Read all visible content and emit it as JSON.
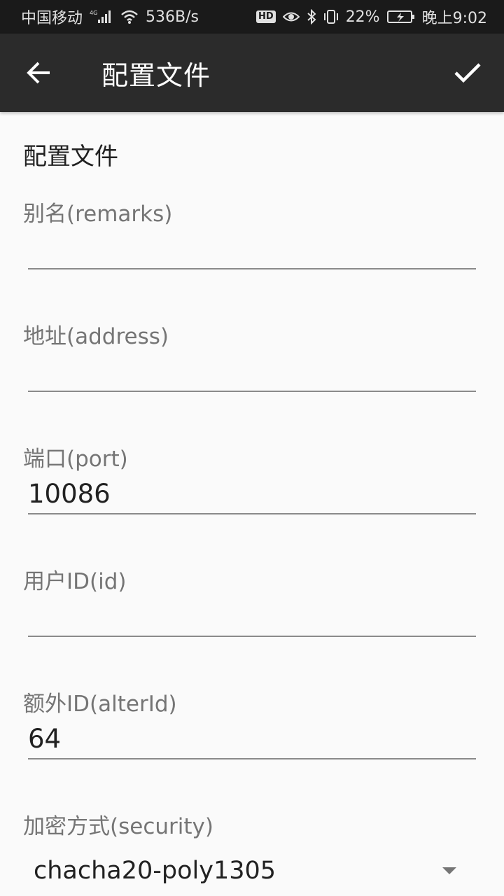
{
  "status_bar": {
    "carrier": "中国移动",
    "network": "4G",
    "speed": "536B/s",
    "hd": "HD",
    "battery": "22%",
    "time": "晚上9:02",
    "icons": [
      "signal-icon",
      "wifi-icon",
      "eye-icon",
      "bluetooth-icon",
      "vibrate-icon",
      "battery-icon"
    ]
  },
  "app_bar": {
    "title": "配置文件",
    "back_icon": "arrow-back-icon",
    "confirm_icon": "check-icon"
  },
  "section": {
    "title": "配置文件"
  },
  "fields": [
    {
      "label": "别名(remarks)",
      "value": ""
    },
    {
      "label": "地址(address)",
      "value": ""
    },
    {
      "label": "端口(port)",
      "value": "10086"
    },
    {
      "label": "用户ID(id)",
      "value": ""
    },
    {
      "label": "额外ID(alterId)",
      "value": "64"
    },
    {
      "label": "加密方式(security)",
      "value": "chacha20-poly1305"
    }
  ],
  "colors": {
    "status_bar_bg": "#1a1a1a",
    "app_bar_bg": "#2b2b2b",
    "page_bg": "#fafafa",
    "label_text": "#757575",
    "value_text": "#212121",
    "underline": "#8a8a8a"
  }
}
